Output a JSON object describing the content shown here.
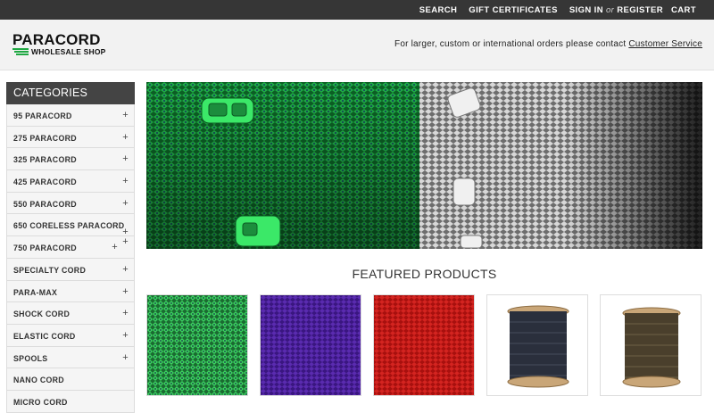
{
  "topnav": {
    "search": "SEARCH",
    "gift": "GIFT CERTIFICATES",
    "signin": "SIGN IN",
    "or": "or",
    "register": "REGISTER",
    "cart": "CART"
  },
  "header": {
    "logo_line1": "PARACORD",
    "logo_line2": "WHOLESALE SHOP",
    "contact_text": "For larger, custom or international orders please contact ",
    "contact_link": "Customer Service"
  },
  "sidebar": {
    "title": "CATEGORIES",
    "items": [
      {
        "label": "95 PARACORD",
        "plus": "+"
      },
      {
        "label": "275 PARACORD",
        "plus": "+"
      },
      {
        "label": "325 PARACORD",
        "plus": "+"
      },
      {
        "label": "425 PARACORD",
        "plus": "+"
      },
      {
        "label": "550 PARACORD",
        "plus": "+"
      },
      {
        "label": "650 CORELESS PARACORD",
        "plus": "+"
      },
      {
        "label": "750 PARACORD",
        "plus": "+"
      },
      {
        "label": "SPECIALTY CORD",
        "plus": "+"
      },
      {
        "label": "PARA-MAX",
        "plus": "+"
      },
      {
        "label": "SHOCK CORD",
        "plus": "+"
      },
      {
        "label": "ELASTIC CORD",
        "plus": "+"
      },
      {
        "label": "SPOOLS",
        "plus": "+"
      },
      {
        "label": "NANO CORD",
        "plus": ""
      },
      {
        "label": "MICRO CORD",
        "plus": ""
      }
    ]
  },
  "featured": {
    "title": "FEATURED PRODUCTS"
  },
  "colors": {
    "topbar": "#363636",
    "accent_green": "#1fa843",
    "category_header": "#444444"
  }
}
